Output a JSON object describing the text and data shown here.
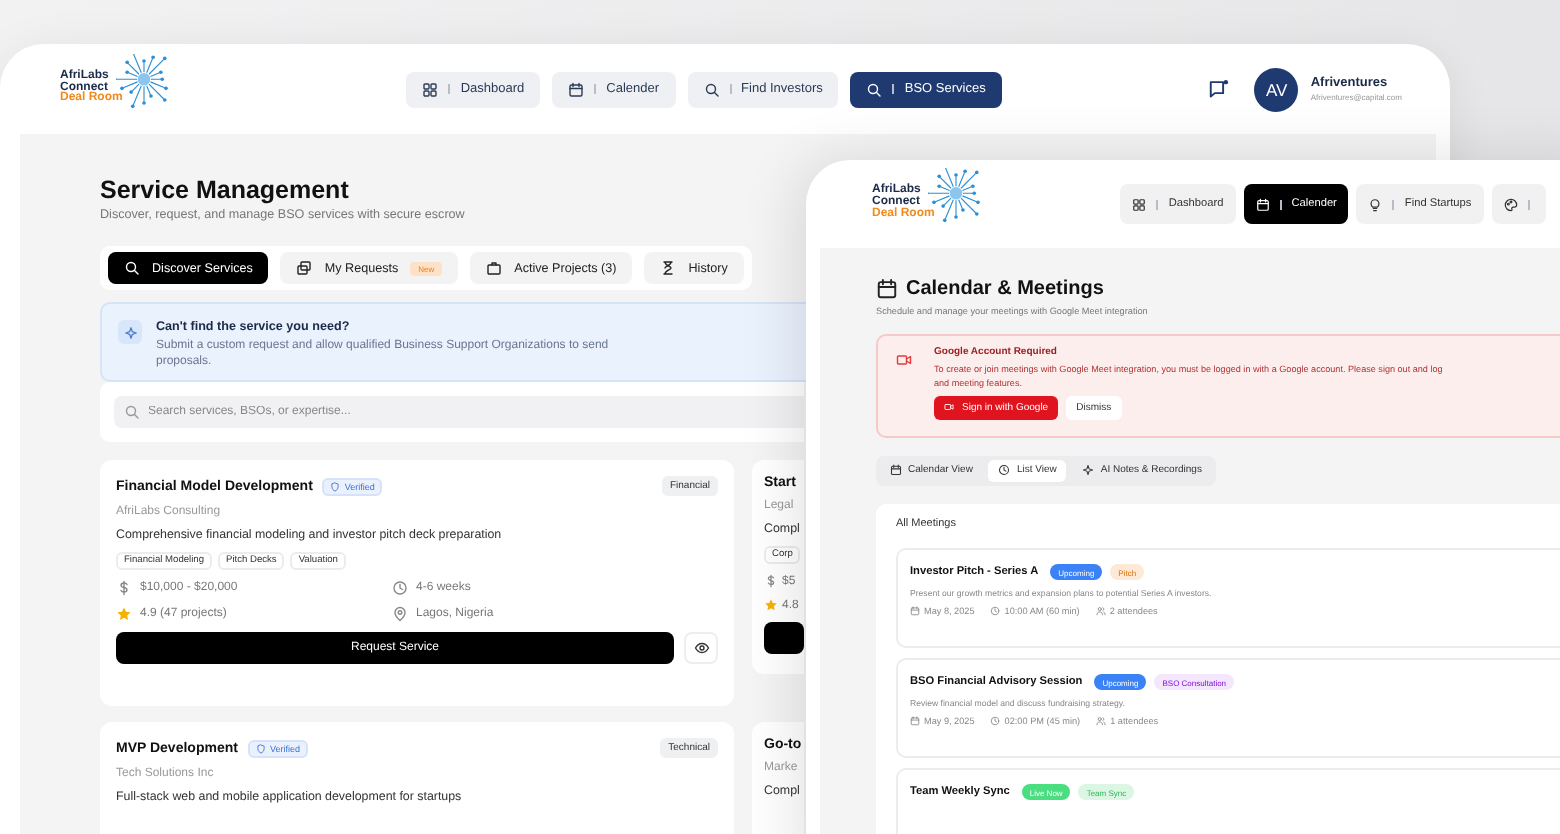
{
  "back_window": {
    "logo": {
      "line_1": "AfriLabs",
      "line_2": "Connect",
      "line_3": "Deal Room"
    },
    "nav": [
      {
        "label": "Dashboard",
        "selected": false
      },
      {
        "label": "Calender",
        "selected": false
      },
      {
        "label": "Find Investors",
        "selected": false
      },
      {
        "label": "BSO Services",
        "selected": true
      }
    ],
    "user": {
      "initials": "AV",
      "name": "Afriventures",
      "email": "Afriventures@capital.com"
    },
    "title": "Service Management",
    "subtitle": "Discover, request, and manage BSO services with secure escrow",
    "tabs": [
      {
        "label": "Discover Services",
        "selected": true
      },
      {
        "label": "My Requests",
        "badge": "New",
        "selected": false
      },
      {
        "label": "Active Projects (3)",
        "selected": false
      },
      {
        "label": "History",
        "selected": false
      }
    ],
    "banner": {
      "title": "Can't find the service you need?",
      "text": "Submit a custom request and allow qualified Business Support Organizations to send proposals."
    },
    "search": {
      "placeholder": "Search services, BSOs, or expertise..."
    },
    "services": [
      {
        "title": "Financial Model Development",
        "verified": true,
        "verified_label": "Verified",
        "category": "Financial",
        "provider": "AfriLabs Consulting",
        "description": "Comprehensive financial modeling and investor pitch deck preparation",
        "tags": [
          "Financial Modeling",
          "Pitch Decks",
          "Valuation"
        ],
        "price": "$10,000 - $20,000",
        "duration": "4-6 weeks",
        "rating": "4.9 (47 projects)",
        "location": "Lagos, Nigeria",
        "button": "Request Service"
      },
      {
        "title": "Start",
        "provider": "Legal",
        "description": "Compl",
        "tags": [
          "Corp"
        ],
        "price": "$5",
        "rating": "4.8",
        "button_bar": true
      },
      {
        "title": "MVP Development",
        "verified": true,
        "verified_label": "Verified",
        "category": "Technical",
        "provider": "Tech Solutions Inc",
        "description": "Full-stack web and mobile application development for startups"
      },
      {
        "title": "Go-to",
        "provider": "Marke",
        "description": "Compl"
      }
    ]
  },
  "front_window": {
    "logo": {
      "line_1": "AfriLabs",
      "line_2": "Connect",
      "line_3": "Deal Room"
    },
    "nav": [
      {
        "label": "Dashboard",
        "selected": false
      },
      {
        "label": "Calender",
        "selected": true
      },
      {
        "label": "Find Startups",
        "selected": false
      },
      {
        "selected": false
      }
    ],
    "title": "Calendar & Meetings",
    "subtitle": "Schedule and manage your meetings with Google Meet integration",
    "alert": {
      "title": "Google Account Required",
      "lines": [
        "To create or join meetings with Google Meet integration, you must be logged in with a Google account. Please sign out and log",
        "and meeting features."
      ],
      "primary": "Sign in with Google",
      "secondary": "Dismiss"
    },
    "tabs": [
      {
        "label": "Calendar View",
        "selected": false
      },
      {
        "label": "List View",
        "selected": true
      },
      {
        "label": "AI Notes & Recordings",
        "selected": false
      }
    ],
    "panel_title": "All Meetings",
    "meetings": [
      {
        "title": "Investor Pitch - Series A",
        "badges": [
          {
            "label": "Upcoming",
            "kind": "solid",
            "color": "#3b82f6"
          },
          {
            "label": "Pitch",
            "kind": "soft",
            "color": "#fde9d6"
          }
        ],
        "description": "Present our growth metrics and expansion plans to potential Series A investors.",
        "date": "May 8, 2025",
        "time": "10:00 AM (60 min)",
        "attendees": "2 attendees"
      },
      {
        "title": "BSO Financial Advisory Session",
        "badges": [
          {
            "label": "Upcoming",
            "kind": "solid",
            "color": "#3b82f6"
          },
          {
            "label": "BSO Consultation",
            "kind": "soft",
            "color": "#f3e6fd"
          }
        ],
        "description": "Review financial model and discuss fundraising strategy.",
        "date": "May 9, 2025",
        "time": "02:00 PM (45 min)",
        "attendees": "1 attendees"
      },
      {
        "title": "Team Weekly Sync",
        "badges": [
          {
            "label": "Live Now",
            "kind": "solid",
            "color": "#4ade80"
          },
          {
            "label": "Team Sync",
            "kind": "soft",
            "color": "#dcf6e4"
          }
        ]
      }
    ]
  }
}
